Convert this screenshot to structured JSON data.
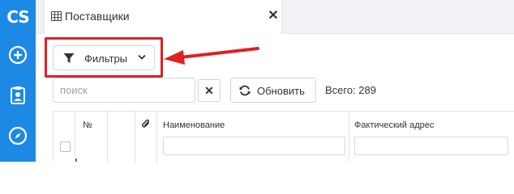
{
  "app": {
    "logo_text": "CS",
    "brand_color": "#1e88e5",
    "rail_icons": [
      "plus-circle-icon",
      "clipboard-user-icon",
      "compass-icon"
    ]
  },
  "tab": {
    "title": "Поставщики",
    "icon": "table-icon",
    "close_label": "✕"
  },
  "toolbar": {
    "filters_label": "Фильтры",
    "search_placeholder": "поиск",
    "search_value": "",
    "clear_label": "✕",
    "refresh_label": "Обновить",
    "total_label": "Всего: 289"
  },
  "annotation": {
    "highlight_color": "#e02020"
  },
  "table": {
    "columns": [
      "",
      "№",
      "",
      "",
      "Наименование",
      "Фактический адрес"
    ]
  }
}
